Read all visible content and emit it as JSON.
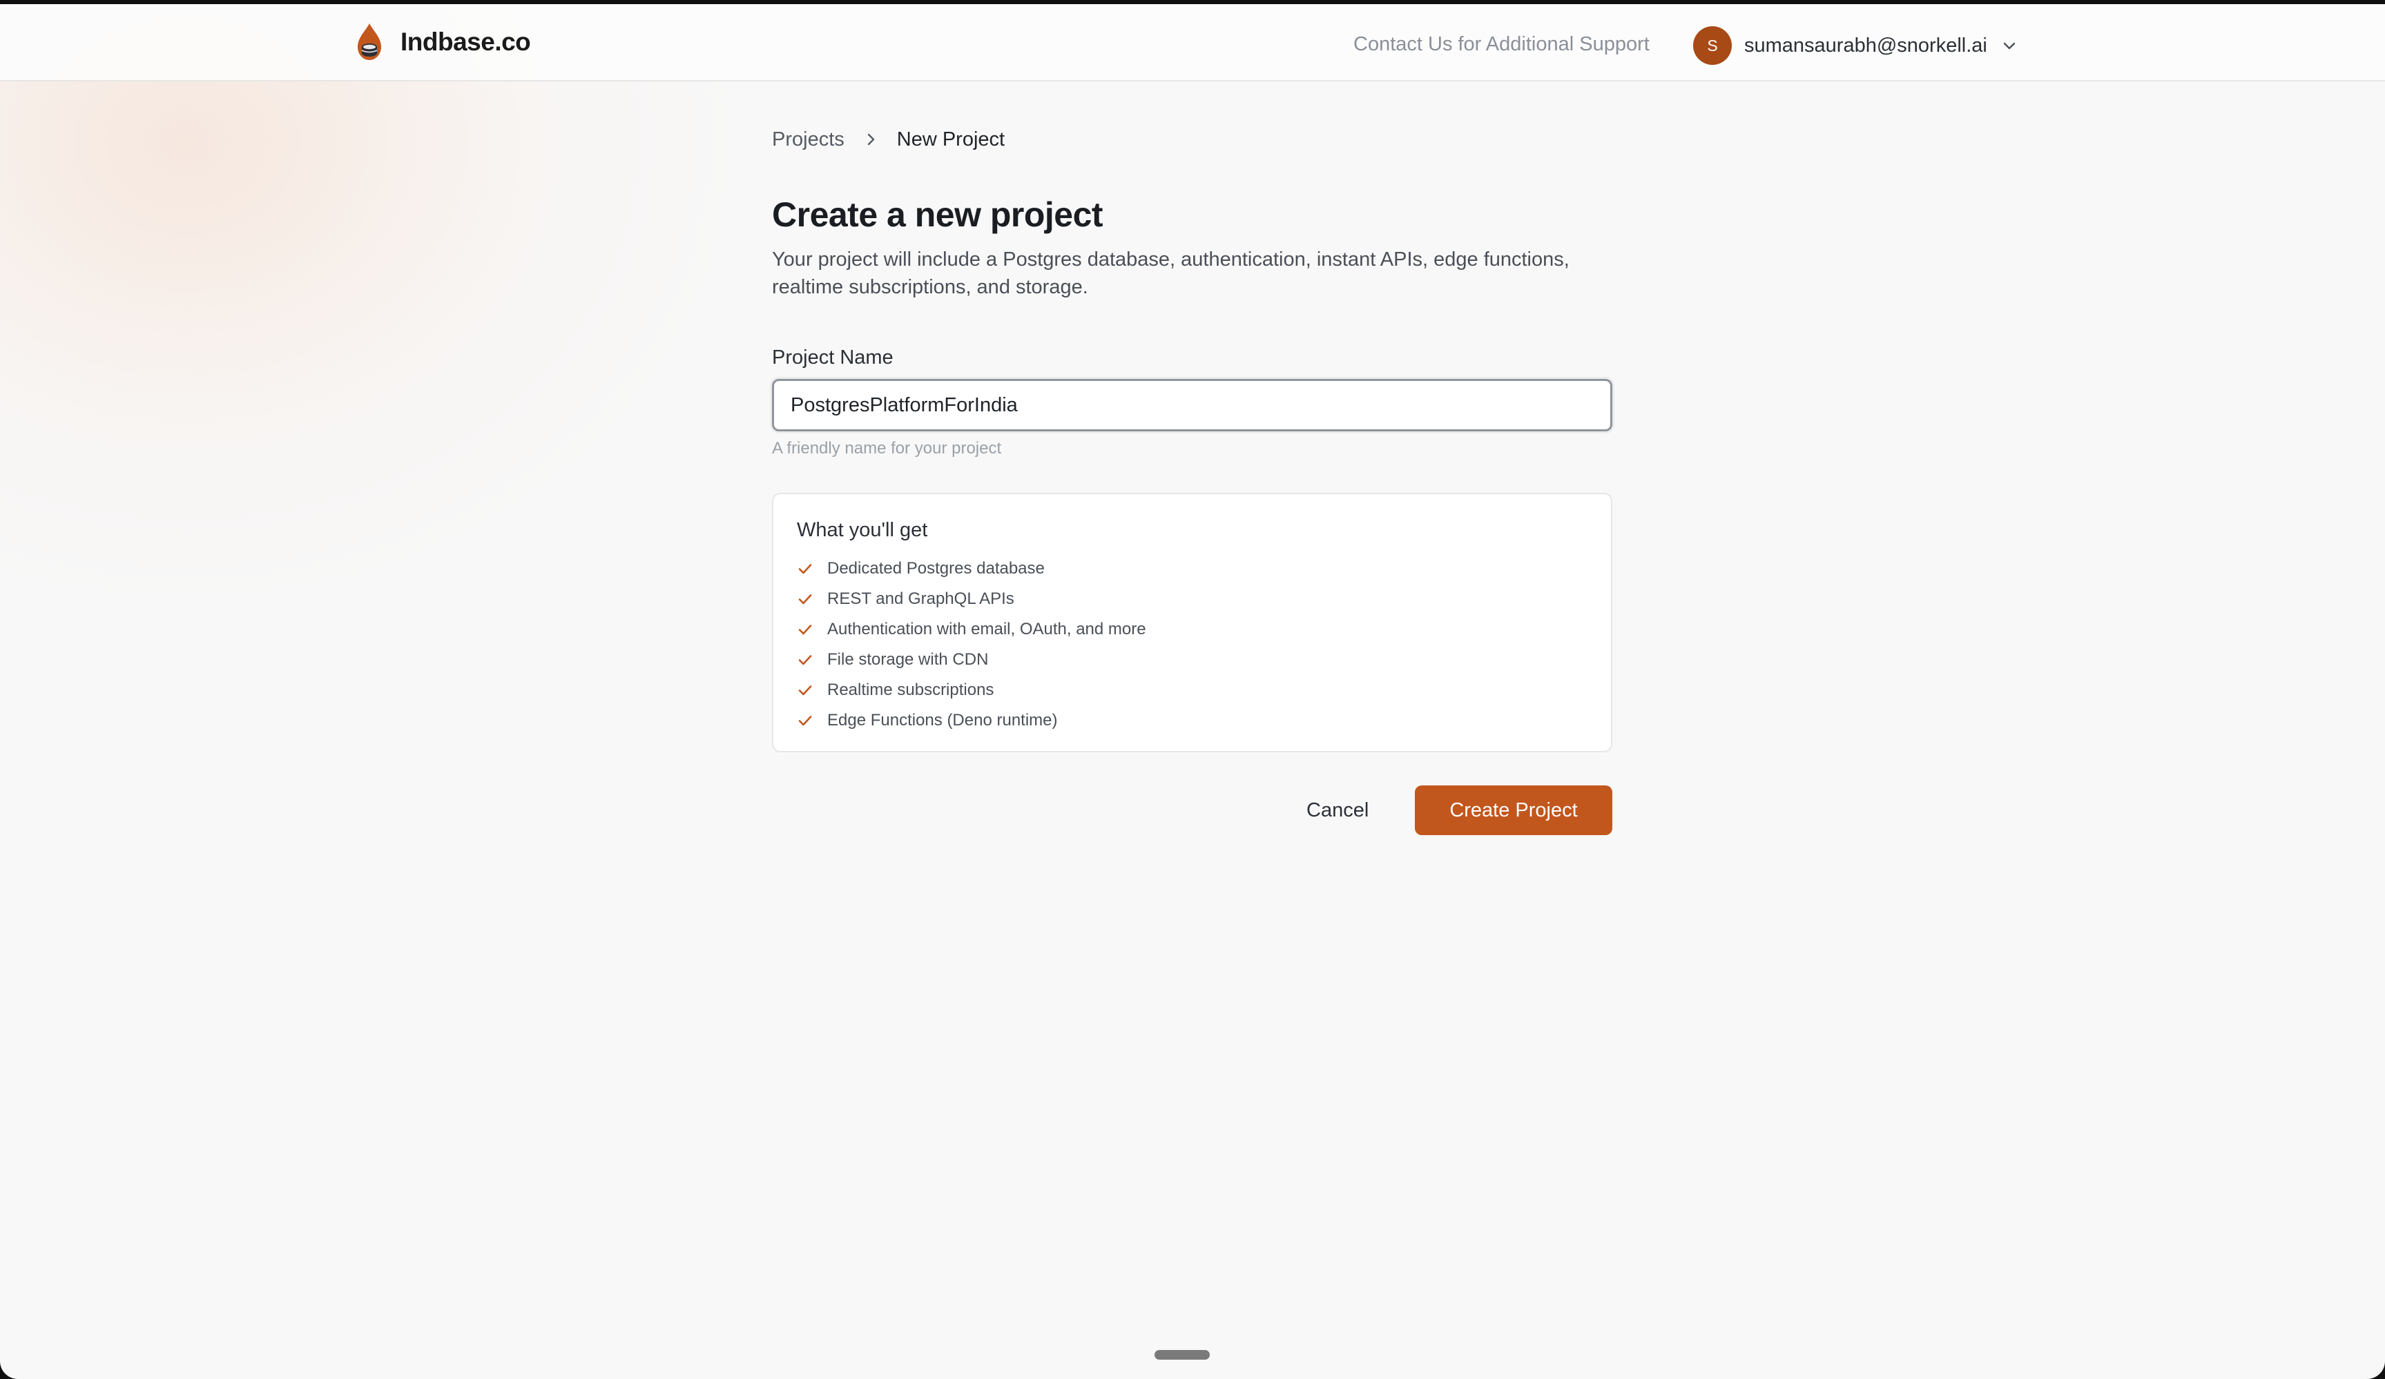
{
  "header": {
    "brand_name": "Indbase.co",
    "support_link": "Contact Us for Additional Support",
    "user": {
      "avatar_initial": "S",
      "email": "sumansaurabh@snorkell.ai"
    }
  },
  "breadcrumb": {
    "parent": "Projects",
    "current": "New Project"
  },
  "page": {
    "title": "Create a new project",
    "description": "Your project will include a Postgres database, authentication, instant APIs, edge functions, realtime subscriptions, and storage."
  },
  "form": {
    "project_name": {
      "label": "Project Name",
      "value": "PostgresPlatformForIndia",
      "hint": "A friendly name for your project"
    }
  },
  "features": {
    "title": "What you'll get",
    "items": [
      "Dedicated Postgres database",
      "REST and GraphQL APIs",
      "Authentication with email, OAuth, and more",
      "File storage with CDN",
      "Realtime subscriptions",
      "Edge Functions (Deno runtime)"
    ]
  },
  "actions": {
    "cancel": "Cancel",
    "create": "Create Project"
  },
  "colors": {
    "accent": "#c2571d",
    "avatar": "#a84a16"
  },
  "icons": {
    "logo": "flame-logo-icon",
    "user_menu": "chevron-down-icon",
    "breadcrumb_separator": "chevron-right-icon",
    "feature_bullet": "check-icon"
  }
}
